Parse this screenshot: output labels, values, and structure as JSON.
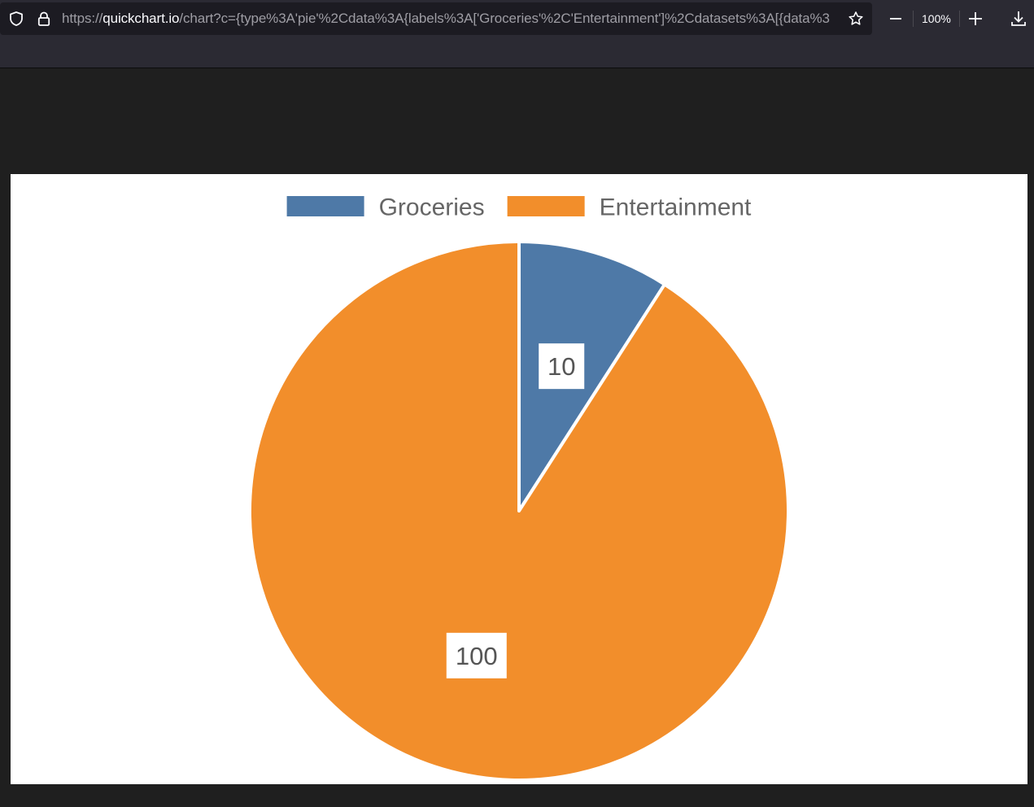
{
  "browser": {
    "url_prefix": "https://",
    "url_host": "quickchart.io",
    "url_rest": "/chart?c={type%3A'pie'%2Cdata%3A{labels%3A['Groceries'%2C'Entertainment']%2Cdatasets%3A[{data%3",
    "zoom_level": "100%",
    "icons": {
      "shield": "tracking-protection-shield-icon",
      "lock": "lock-icon",
      "star": "bookmark-star-icon",
      "zoom_out": "minus-icon",
      "zoom_in": "plus-icon",
      "download": "download-icon"
    },
    "colors": {
      "toolbar": "#2b2a33",
      "urlbar": "#1c1b22",
      "page_bg": "#1f1f1f"
    }
  },
  "chart_data": {
    "type": "pie",
    "categories": [
      "Groceries",
      "Entertainment"
    ],
    "values": [
      10,
      100
    ],
    "colors": [
      "#4e79a7",
      "#f28e2b"
    ],
    "data_labels": [
      "10",
      "100"
    ],
    "legend": "top",
    "legend_color": "#666666"
  }
}
